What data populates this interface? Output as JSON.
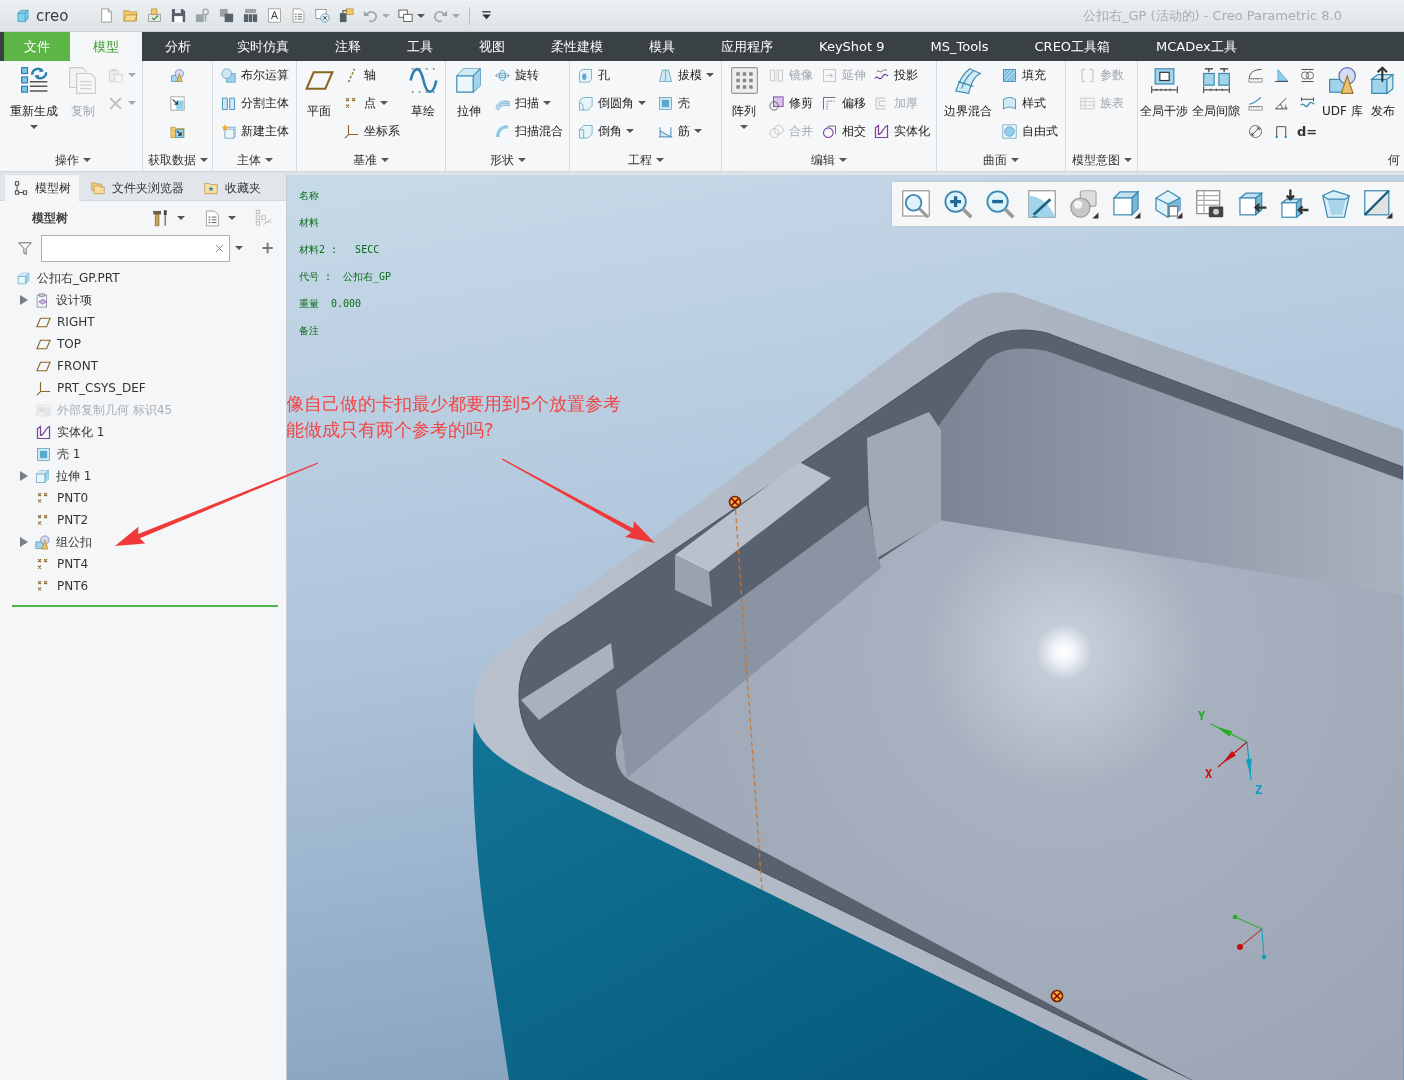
{
  "window": {
    "app_name": "creo",
    "title": "公扣右_GP (活动的) - Creo Parametric 8.0"
  },
  "ribbon_tabs": [
    {
      "label": "文件",
      "kind": "file",
      "selected": false
    },
    {
      "label": "模型",
      "kind": "tab",
      "selected": true
    },
    {
      "label": "分析",
      "kind": "tab",
      "selected": false
    },
    {
      "label": "实时仿真",
      "kind": "tab",
      "selected": false
    },
    {
      "label": "注释",
      "kind": "tab",
      "selected": false
    },
    {
      "label": "工具",
      "kind": "tab",
      "selected": false
    },
    {
      "label": "视图",
      "kind": "tab",
      "selected": false
    },
    {
      "label": "柔性建模",
      "kind": "tab",
      "selected": false
    },
    {
      "label": "模具",
      "kind": "tab",
      "selected": false
    },
    {
      "label": "应用程序",
      "kind": "tab",
      "selected": false
    },
    {
      "label": "KeyShot 9",
      "kind": "tab",
      "selected": false
    },
    {
      "label": "MS_Tools",
      "kind": "tab",
      "selected": false
    },
    {
      "label": "CREO工具箱",
      "kind": "tab",
      "selected": false
    },
    {
      "label": "MCADex工具",
      "kind": "tab",
      "selected": false
    }
  ],
  "ribbon_groups": [
    {
      "label": "操作",
      "menu": true,
      "columns": [
        [
          {
            "kind": "large",
            "label": "重新生成",
            "menu": true,
            "disabled": false
          }
        ],
        [
          {
            "kind": "large",
            "label": "复制",
            "menu": false,
            "disabled": true
          }
        ],
        [
          {
            "kind": "icon",
            "menu": true,
            "disabled": true
          },
          {
            "kind": "icon",
            "menu": true,
            "disabled": true
          }
        ]
      ]
    },
    {
      "label": "获取数据",
      "menu": true,
      "columns": [
        [
          {
            "kind": "icon",
            "menu": false,
            "disabled": false
          },
          {
            "kind": "icon",
            "menu": false,
            "disabled": false
          },
          {
            "kind": "icon",
            "menu": false,
            "disabled": false
          }
        ]
      ]
    },
    {
      "label": "主体",
      "menu": true,
      "columns": [
        [
          {
            "kind": "small",
            "label": "布尔运算",
            "menu": false,
            "disabled": false
          },
          {
            "kind": "small",
            "label": "分割主体",
            "menu": false,
            "disabled": false
          },
          {
            "kind": "small",
            "label": "新建主体",
            "menu": false,
            "disabled": false
          }
        ]
      ]
    },
    {
      "label": "基准",
      "menu": true,
      "columns": [
        [
          {
            "kind": "large",
            "label": "平面",
            "menu": false,
            "disabled": false
          }
        ],
        [
          {
            "kind": "small",
            "label": "轴",
            "menu": false,
            "disabled": false
          },
          {
            "kind": "small",
            "label": "点",
            "menu": true,
            "disabled": false
          },
          {
            "kind": "small",
            "label": "坐标系",
            "menu": false,
            "disabled": false
          }
        ],
        [
          {
            "kind": "large",
            "label": "草绘",
            "menu": false,
            "disabled": false
          }
        ]
      ]
    },
    {
      "label": "形状",
      "menu": true,
      "columns": [
        [
          {
            "kind": "large",
            "label": "拉伸",
            "menu": false,
            "disabled": false
          }
        ],
        [
          {
            "kind": "small",
            "label": "旋转",
            "menu": false,
            "disabled": false
          },
          {
            "kind": "small",
            "label": "扫描",
            "menu": true,
            "disabled": false
          },
          {
            "kind": "small",
            "label": "扫描混合",
            "menu": false,
            "disabled": false
          }
        ]
      ]
    },
    {
      "label": "工程",
      "menu": true,
      "columns": [
        [
          {
            "kind": "small",
            "label": "孔",
            "menu": false,
            "disabled": false
          },
          {
            "kind": "small",
            "label": "倒圆角",
            "menu": true,
            "disabled": false
          },
          {
            "kind": "small",
            "label": "倒角",
            "menu": true,
            "disabled": false
          }
        ],
        [
          {
            "kind": "small",
            "label": "拔模",
            "menu": true,
            "disabled": false
          },
          {
            "kind": "small",
            "label": "壳",
            "menu": false,
            "disabled": false
          },
          {
            "kind": "small",
            "label": "筋",
            "menu": true,
            "disabled": false
          }
        ]
      ]
    },
    {
      "label": "编辑",
      "menu": true,
      "columns": [
        [
          {
            "kind": "large",
            "label": "阵列",
            "menu": true,
            "disabled": false
          }
        ],
        [
          {
            "kind": "small",
            "label": "镜像",
            "menu": false,
            "disabled": true
          },
          {
            "kind": "small",
            "label": "修剪",
            "menu": false,
            "disabled": false
          },
          {
            "kind": "small",
            "label": "合并",
            "menu": false,
            "disabled": true
          }
        ],
        [
          {
            "kind": "small",
            "label": "延伸",
            "menu": false,
            "disabled": true
          },
          {
            "kind": "small",
            "label": "偏移",
            "menu": false,
            "disabled": false
          },
          {
            "kind": "small",
            "label": "相交",
            "menu": false,
            "disabled": false
          }
        ],
        [
          {
            "kind": "small",
            "label": "投影",
            "menu": false,
            "disabled": false
          },
          {
            "kind": "small",
            "label": "加厚",
            "menu": false,
            "disabled": true
          },
          {
            "kind": "small",
            "label": "实体化",
            "menu": false,
            "disabled": false
          }
        ]
      ]
    },
    {
      "label": "曲面",
      "menu": true,
      "columns": [
        [
          {
            "kind": "large",
            "label": "边界混合",
            "menu": false,
            "disabled": false
          }
        ],
        [
          {
            "kind": "small",
            "label": "填充",
            "menu": false,
            "disabled": false
          },
          {
            "kind": "small",
            "label": "样式",
            "menu": false,
            "disabled": false
          },
          {
            "kind": "small",
            "label": "自由式",
            "menu": false,
            "disabled": false
          }
        ]
      ]
    },
    {
      "label": "模型意图",
      "menu": true,
      "columns": [
        [
          {
            "kind": "small",
            "label": "参数",
            "menu": false,
            "disabled": true
          },
          {
            "kind": "small",
            "label": "族表",
            "menu": false,
            "disabled": true
          }
        ]
      ]
    },
    {
      "label": "何",
      "menu": false,
      "columns": [
        [
          {
            "kind": "large",
            "label": "全局干涉",
            "menu": false,
            "disabled": false
          }
        ],
        [
          {
            "kind": "large",
            "label": "全局间隙",
            "menu": false,
            "disabled": false
          }
        ],
        [
          {
            "kind": "icon",
            "menu": false,
            "disabled": false
          },
          {
            "kind": "icon",
            "menu": false,
            "disabled": false
          },
          {
            "kind": "icon",
            "menu": false,
            "disabled": false
          }
        ],
        [
          {
            "kind": "icon",
            "menu": false,
            "disabled": false
          },
          {
            "kind": "icon",
            "menu": false,
            "disabled": false
          },
          {
            "kind": "icon",
            "menu": false,
            "disabled": false
          }
        ],
        [
          {
            "kind": "icon",
            "menu": false,
            "disabled": false
          },
          {
            "kind": "icon",
            "menu": false,
            "disabled": false
          },
          {
            "kind": "icon",
            "glyph": "d=",
            "menu": false,
            "disabled": false
          }
        ],
        [
          {
            "kind": "large",
            "label": "UDF 库",
            "menu": false,
            "disabled": false
          }
        ],
        [
          {
            "kind": "large",
            "label": "发布",
            "menu": false,
            "disabled": false
          }
        ]
      ]
    }
  ],
  "model_tree": {
    "tabs": [
      {
        "label": "模型树",
        "selected": true
      },
      {
        "label": "文件夹浏览器",
        "selected": false
      },
      {
        "label": "收藏夹",
        "selected": false
      }
    ],
    "title": "模型树",
    "items": [
      {
        "label": "公扣右_GP.PRT",
        "disabled": false,
        "children": [
          {
            "label": "设计项",
            "disabled": false,
            "expanded": false
          },
          {
            "label": "RIGHT",
            "disabled": false
          },
          {
            "label": "TOP",
            "disabled": false
          },
          {
            "label": "FRONT",
            "disabled": false
          },
          {
            "label": "PRT_CSYS_DEF",
            "disabled": false
          },
          {
            "label": "外部复制几何 标识45",
            "disabled": true
          },
          {
            "label": "实体化 1",
            "disabled": false
          },
          {
            "label": "壳 1",
            "disabled": false
          },
          {
            "label": "拉伸 1",
            "disabled": false,
            "expanded": false
          },
          {
            "label": "PNT0",
            "disabled": false
          },
          {
            "label": "PNT2",
            "disabled": false
          },
          {
            "label": "组公扣",
            "disabled": false,
            "expanded": false
          },
          {
            "label": "PNT4",
            "disabled": false
          },
          {
            "label": "PNT6",
            "disabled": false
          }
        ]
      }
    ]
  },
  "graphics": {
    "notes": [
      "名称",
      "材料",
      "材料2 :   SECC",
      "代号 :  公扣右_GP",
      "重量  0.000",
      "备注"
    ],
    "annotation": [
      "像自己做的卡扣最少都要用到5个放置参考",
      "能做成只有两个参考的吗?"
    ],
    "axis_labels": [
      "Y",
      "X",
      "Z"
    ]
  }
}
